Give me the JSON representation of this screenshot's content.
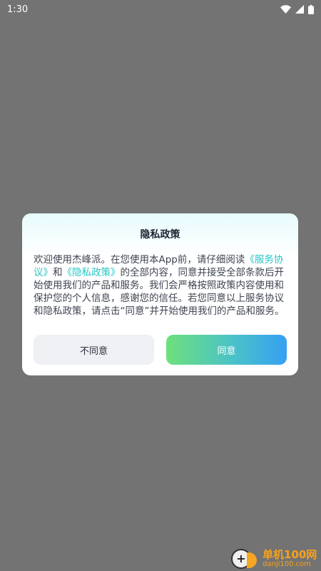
{
  "status_bar": {
    "time": "1:30",
    "icons": [
      "wifi-icon",
      "signal-icon",
      "battery-icon"
    ]
  },
  "dialog": {
    "title": "隐私政策",
    "body": {
      "intro": "欢迎使用杰峰派。在您使用本App前，请仔细阅读",
      "service_link": "《服务协议》",
      "and": "和",
      "privacy_link": "《隐私政策》",
      "rest": "的全部内容，同意并接受全部条款后开始使用我们的产品和服务。我们会严格按照政策内容使用和保护您的个人信息，感谢您的信任。若您同意以上服务协议和隐私政策，请点击“同意”并开始使用我们的产品和服务。"
    },
    "buttons": {
      "disagree": "不同意",
      "agree": "同意"
    }
  },
  "watermark": {
    "name": "单机100网",
    "url": "danji100.com"
  },
  "colors": {
    "overlay": "#737373",
    "link": "#26c6c6",
    "agree_gradient_start": "#6ee07c",
    "agree_gradient_end": "#36a0f2",
    "disagree_bg": "#eef0f4",
    "watermark": "#f7a21b"
  }
}
